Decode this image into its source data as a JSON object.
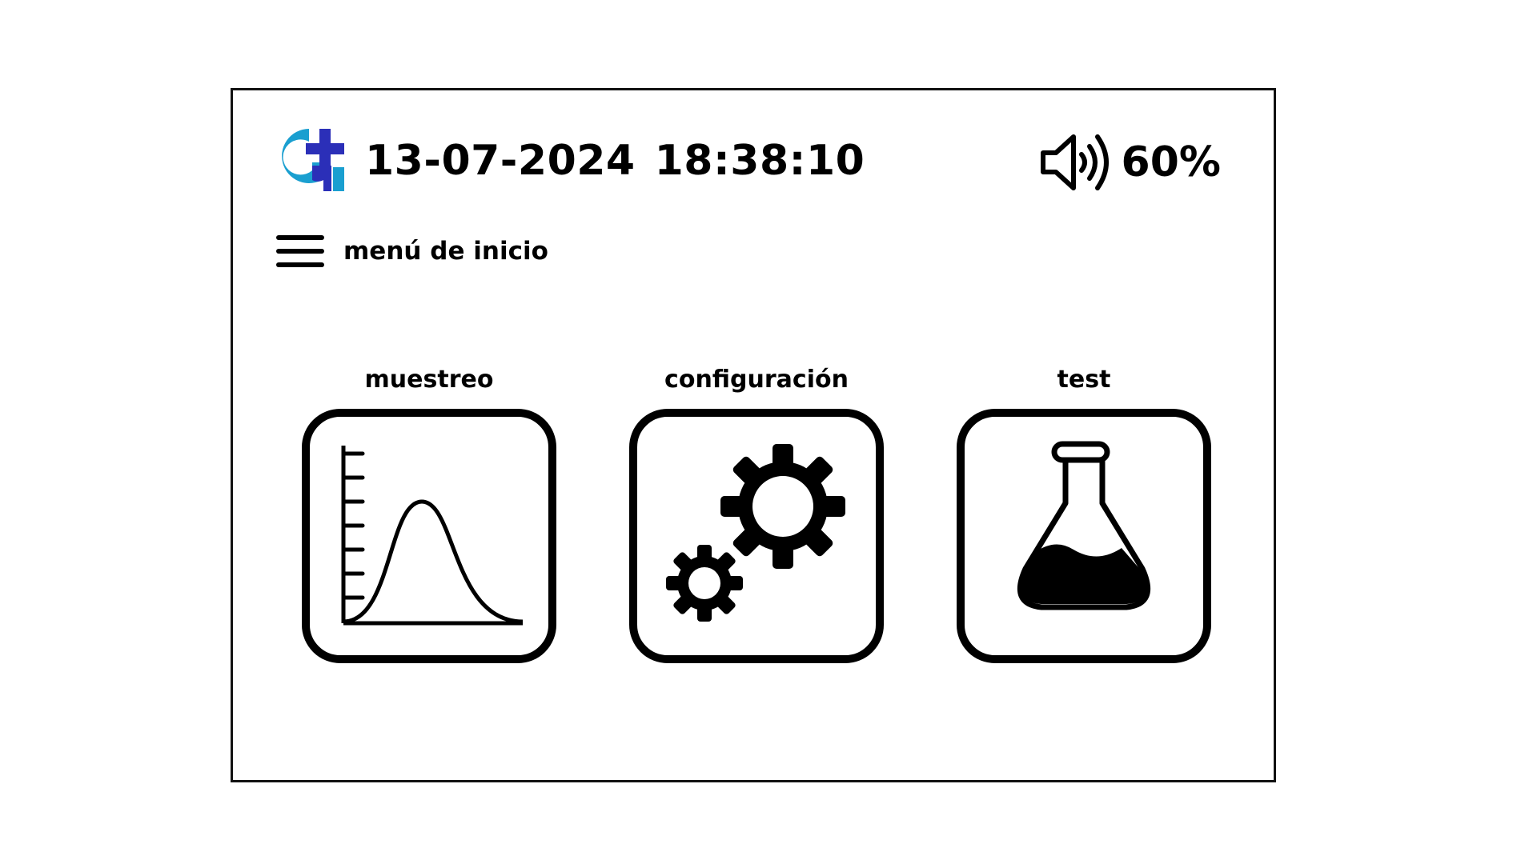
{
  "header": {
    "date": "13-07-2024",
    "time": "18:38:10",
    "volume": "60%",
    "logo_icon": "brand-logo-icon",
    "volume_icon": "speaker-icon"
  },
  "menu": {
    "label": "menú de inicio",
    "icon": "hamburger-icon"
  },
  "tiles": [
    {
      "label": "muestreo",
      "icon": "bell-curve-chart-icon"
    },
    {
      "label": "configuración",
      "icon": "gears-icon"
    },
    {
      "label": "test",
      "icon": "flask-icon"
    }
  ],
  "colors": {
    "logo_cyan": "#1a9fd0",
    "logo_blue": "#2b2fb8",
    "foreground": "#000000",
    "background": "#ffffff"
  }
}
